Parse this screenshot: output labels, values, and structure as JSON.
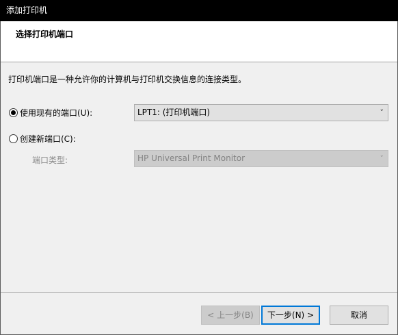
{
  "window": {
    "title": "添加打印机"
  },
  "header": {
    "title": "选择打印机端口"
  },
  "content": {
    "description": "打印机端口是一种允许你的计算机与打印机交换信息的连接类型。",
    "use_existing": {
      "label": "使用现有的端口(U):",
      "selected": true,
      "dropdown_value": "LPT1: (打印机端口)"
    },
    "create_new": {
      "label": "创建新端口(C):",
      "selected": false,
      "port_type_label": "端口类型:",
      "port_type_value": "HP Universal Print Monitor"
    }
  },
  "footer": {
    "back_label": "< 上一步(B)",
    "next_label": "下一步(N) >",
    "cancel_label": "取消"
  },
  "icons": {
    "dropdown": "chevron-down-icon"
  }
}
